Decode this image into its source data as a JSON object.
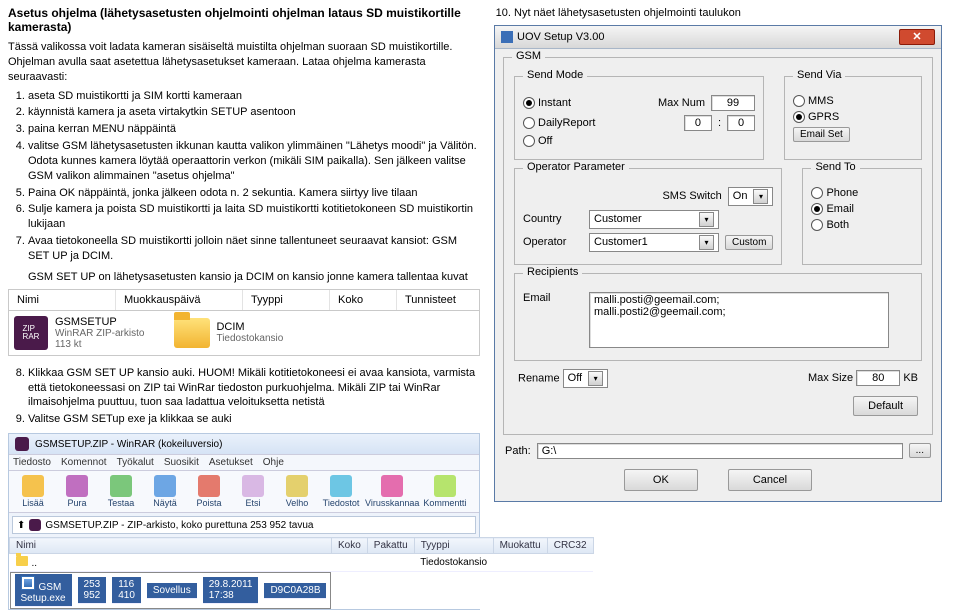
{
  "leftcol": {
    "title": "Asetus ohjelma (lähetysasetusten ohjelmointi ohjelman lataus SD muistikortille kamerasta)",
    "intro": "Tässä valikossa voit ladata kameran sisäiseltä muistilta ohjelman suoraan SD muistikortille. Ohjelman avulla saat asetettua lähetysasetukset kameraan. Lataa ohjelma kamerasta seuraavasti:",
    "steps": [
      "aseta SD muistikortti ja SIM kortti kameraan",
      "käynnistä kamera ja aseta virtakytkin SETUP asentoon",
      "paina kerran MENU näppäintä",
      "valitse GSM lähetysasetusten ikkunan kautta valikon ylimmäinen \"Lähetys moodi\" ja Välitön. Odota kunnes kamera löytää operaattorin verkon (mikäli SIM paikalla). Sen jälkeen valitse GSM valikon alimmainen \"asetus ohjelma\"",
      "Paina OK näppäintä, jonka jälkeen odota n. 2 sekuntia. Kamera siirtyy live tilaan",
      "Sulje kamera ja poista SD muistikortti ja laita SD muistikortti kotitietokoneen SD muistikortin lukijaan",
      "Avaa tietokoneella SD muistikortti jolloin näet sinne tallentuneet seuraavat kansiot: GSM SET UP ja DCIM."
    ],
    "dcim_note": "GSM SET UP on lähetysasetusten kansio ja DCIM on kansio jonne kamera tallentaa kuvat",
    "file_hdr": {
      "c1": "Nimi",
      "c2": "Muokkauspäivä",
      "c3": "Tyyppi",
      "c4": "Koko",
      "c5": "Tunnisteet"
    },
    "f1": {
      "name": "GSMSETUP",
      "sub1": "WinRAR ZIP-arkisto",
      "sub2": "113 kt"
    },
    "f2": {
      "name": "DCIM",
      "sub": "Tiedostokansio"
    },
    "steps2": [
      "Klikkaa GSM SET UP kansio auki. HUOM! Mikäli kotitietokoneesi ei avaa kansiota, varmista että tietokoneessasi on ZIP tai WinRar tiedoston purkuohjelma. Mikäli ZIP tai WinRar ilmaisohjelma puuttuu, tuon saa ladattua veloituksetta netistä",
      "Valitse GSM SETup exe ja klikkaa se auki"
    ],
    "rar": {
      "title": "GSMSETUP.ZIP - WinRAR (kokeiluversio)",
      "menu": [
        "Tiedosto",
        "Komennot",
        "Työkalut",
        "Suosikit",
        "Asetukset",
        "Ohje"
      ],
      "tb": [
        "Lisää",
        "Pura",
        "Testaa",
        "Näytä",
        "Poista",
        "Etsi",
        "Velho",
        "Tiedostot",
        "Virusskannaa",
        "Kommentti"
      ],
      "addr": "GSMSETUP.ZIP - ZIP-arkisto, koko purettuna 253 952 tavua",
      "th": [
        "Nimi",
        "Koko",
        "Pakattu",
        "Tyyppi",
        "Muokattu",
        "CRC32"
      ],
      "r1": {
        "name": "..",
        "type": "Tiedostokansio"
      },
      "r2": {
        "name": "GSM Setup.exe",
        "size": "253 952",
        "packed": "116 410",
        "type": "Sovellus",
        "mod": "29.8.2011 17:38",
        "crc": "D9C0A28B"
      }
    }
  },
  "rightcol": {
    "step10": "Nyt näet lähetysasetusten ohjelmointi taulukon",
    "dlg": {
      "title": "UOV Setup V3.00",
      "gsm": "GSM",
      "sendmode": {
        "label": "Send Mode",
        "instant": "Instant",
        "daily": "DailyReport",
        "off": "Off",
        "maxnum": "Max Num",
        "maxnum_val": "99",
        "daily_val": "0",
        "daily_val2": "0"
      },
      "sendvia": {
        "label": "Send Via",
        "mms": "MMS",
        "gprs": "GPRS",
        "emailset": "Email Set"
      },
      "op": {
        "label": "Operator Parameter",
        "country": "Country",
        "country_val": "Customer",
        "operator": "Operator",
        "operator_val": "Customer1",
        "custom": "Custom",
        "sms": "SMS Switch",
        "sms_val": "On"
      },
      "sendto": {
        "label": "Send To",
        "phone": "Phone",
        "email": "Email",
        "both": "Both"
      },
      "recipients": {
        "label": "Recipients",
        "email": "Email",
        "email_val": "malli.posti@geemail.com;\nmalli.posti2@geemail.com;"
      },
      "rename": {
        "label": "Rename",
        "val": "Off"
      },
      "maxsize": {
        "label": "Max Size",
        "val": "80",
        "unit": "KB"
      },
      "default": "Default",
      "path": {
        "label": "Path:",
        "val": "G:\\",
        "browse": "..."
      },
      "ok": "OK",
      "cancel": "Cancel"
    }
  }
}
